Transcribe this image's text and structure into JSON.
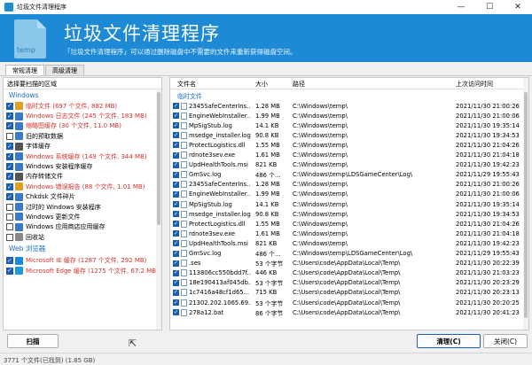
{
  "window": {
    "title": "垃圾文件清理程序",
    "minimize": "—",
    "maximize": "☐",
    "close": "✕"
  },
  "banner": {
    "heading": "垃圾文件清理程序",
    "subtitle": "「垃圾文件清理程序」可以通过删除磁盘中不需要的文件来重新获得磁盘空间。",
    "icon_text": "temp",
    "color": "#1e8ad6"
  },
  "tabs": [
    "常规清理",
    "高级清理"
  ],
  "left": {
    "header": "选择要扫描的区域",
    "groups": [
      {
        "name": "Windows",
        "items": [
          {
            "label": "临时文件 (697 个文件, 882 MB)",
            "checked": true,
            "red": true,
            "icon_color": "#e0a020"
          },
          {
            "label": "Windows 日志文件 (245 个文件, 183 MB)",
            "checked": true,
            "red": true,
            "icon_color": "#3a78c8"
          },
          {
            "label": "缩略图缓存 (30 个文件, 11.0 MB)",
            "checked": true,
            "red": true,
            "icon_color": "#3a78c8"
          },
          {
            "label": "旧的预取数据",
            "checked": false,
            "red": false,
            "icon_color": "#3a78c8"
          },
          {
            "label": "字体缓存",
            "checked": true,
            "red": false,
            "icon_color": "#555555"
          },
          {
            "label": "Windows 系统缓存 (149 个文件, 344 MB)",
            "checked": true,
            "red": true,
            "icon_color": "#3a78c8"
          },
          {
            "label": "Windows 安装程序缓存",
            "checked": true,
            "red": false,
            "icon_color": "#3a78c8"
          },
          {
            "label": "内存转储文件",
            "checked": true,
            "red": false,
            "icon_color": "#555555"
          },
          {
            "label": "Windows 错误报告 (88 个文件, 1.01 MB)",
            "checked": true,
            "red": true,
            "icon_color": "#e0a020"
          },
          {
            "label": "Chkdsk 文件碎片",
            "checked": true,
            "red": false,
            "icon_color": "#3a78c8"
          },
          {
            "label": "过时的 Windows 安装程序",
            "checked": false,
            "red": false,
            "icon_color": "#3a78c8"
          },
          {
            "label": "Windows 更新文件",
            "checked": false,
            "red": false,
            "icon_color": "#3a78c8"
          },
          {
            "label": "Windows 应用商店应用缓存",
            "checked": false,
            "red": false,
            "icon_color": "#3a78c8"
          },
          {
            "label": "回收站",
            "checked": false,
            "red": false,
            "icon_color": "#888888"
          }
        ]
      },
      {
        "name": "Web 浏览器",
        "items": [
          {
            "label": "Microsoft IE 缓存 (1287 个文件, 292 MB)",
            "checked": true,
            "red": true,
            "icon_color": "#1e8ad6"
          },
          {
            "label": "Microsoft Edge 缓存 (1275 个文件, 67.2 MB)",
            "checked": true,
            "red": true,
            "icon_color": "#1e9ad6"
          }
        ]
      }
    ]
  },
  "right": {
    "columns": {
      "name": "文件名",
      "size": "大小",
      "path": "路径",
      "time": "上次访问时间"
    },
    "group": "临时文件",
    "rows": [
      {
        "name": "2345SafeCenterIns...",
        "size": "1.28 MB",
        "path": "C:\\Windows\\temp\\",
        "time": "2021/11/30 21:00:26"
      },
      {
        "name": "EngineWebInstaller...",
        "size": "1.99 MB",
        "path": "C:\\Windows\\temp\\",
        "time": "2021/11/30 21:00:06"
      },
      {
        "name": "MpSigStub.log",
        "size": "14.1 KB",
        "path": "C:\\Windows\\temp\\",
        "time": "2021/11/30 19:35:14"
      },
      {
        "name": "msedge_installer.log",
        "size": "90.8 KB",
        "path": "C:\\Windows\\temp\\",
        "time": "2021/11/30 19:34:53"
      },
      {
        "name": "ProtectLogistics.dll",
        "size": "1.55 MB",
        "path": "C:\\Windows\\temp\\",
        "time": "2021/11/30 21:04:26"
      },
      {
        "name": "rdnote3sev.exe",
        "size": "1.61 MB",
        "path": "C:\\Windows\\temp\\",
        "time": "2021/11/30 21:04:18"
      },
      {
        "name": "UpdHealthTools.msi",
        "size": "821 KB",
        "path": "C:\\Windows\\temp\\",
        "time": "2021/11/30 19:42:23"
      },
      {
        "name": "GmSvc.log",
        "size": "486 个...",
        "path": "C:\\Windows\\temp\\LDSGameCenter\\Log\\",
        "time": "2021/11/29 19:55:43"
      },
      {
        "name": "2345SafeCenterIns...",
        "size": "1.28 MB",
        "path": "C:\\Windows\\temp\\",
        "time": "2021/11/30 21:00:26"
      },
      {
        "name": "EngineWebInstaller...",
        "size": "1.99 MB",
        "path": "C:\\Windows\\temp\\",
        "time": "2021/11/30 21:00:06"
      },
      {
        "name": "MpSigStub.log",
        "size": "14.1 KB",
        "path": "C:\\Windows\\temp\\",
        "time": "2021/11/30 19:35:14"
      },
      {
        "name": "msedge_installer.log",
        "size": "90.8 KB",
        "path": "C:\\Windows\\temp\\",
        "time": "2021/11/30 19:34:53"
      },
      {
        "name": "ProtectLogistics.dll",
        "size": "1.55 MB",
        "path": "C:\\Windows\\temp\\",
        "time": "2021/11/30 21:04:26"
      },
      {
        "name": "rdnote3sev.exe",
        "size": "1.61 MB",
        "path": "C:\\Windows\\temp\\",
        "time": "2021/11/30 21:04:18"
      },
      {
        "name": "UpdHealthTools.msi",
        "size": "821 KB",
        "path": "C:\\Windows\\temp\\",
        "time": "2021/11/30 19:42:23"
      },
      {
        "name": "GmSvc.log",
        "size": "486 个...",
        "path": "C:\\Windows\\temp\\LDSGameCenter\\Log\\",
        "time": "2021/11/29 19:55:43"
      },
      {
        "name": ".ses",
        "size": "53 个字节",
        "path": "C:\\Users\\code\\AppData\\Local\\Temp\\",
        "time": "2021/11/30 20:22:39"
      },
      {
        "name": "113806cc550bdd7f...",
        "size": "446 KB",
        "path": "C:\\Users\\code\\AppData\\Local\\Temp\\",
        "time": "2021/11/30 21:03:23"
      },
      {
        "name": "18e190413af045db...",
        "size": "53 个字节",
        "path": "C:\\Users\\code\\AppData\\Local\\Temp\\",
        "time": "2021/11/30 20:23:29"
      },
      {
        "name": "1c7416a48cf1d65...",
        "size": "715 KB",
        "path": "C:\\Users\\code\\AppData\\Local\\Temp\\",
        "time": "2021/11/30 20:23:13"
      },
      {
        "name": "21302.202.1065.69...",
        "size": "53 个字节",
        "path": "C:\\Users\\code\\AppData\\Local\\Temp\\",
        "time": "2021/11/30 20:20:25"
      },
      {
        "name": "278a12.bat",
        "size": "86 个字节",
        "path": "C:\\Users\\code\\AppData\\Local\\Temp\\",
        "time": "2021/11/30 20:41:23"
      }
    ]
  },
  "buttons": {
    "scan": "扫描",
    "clean": "清理(C)",
    "close": "关闭(C)"
  },
  "status": "3771 个文件(已找到) (1.85 GB)"
}
